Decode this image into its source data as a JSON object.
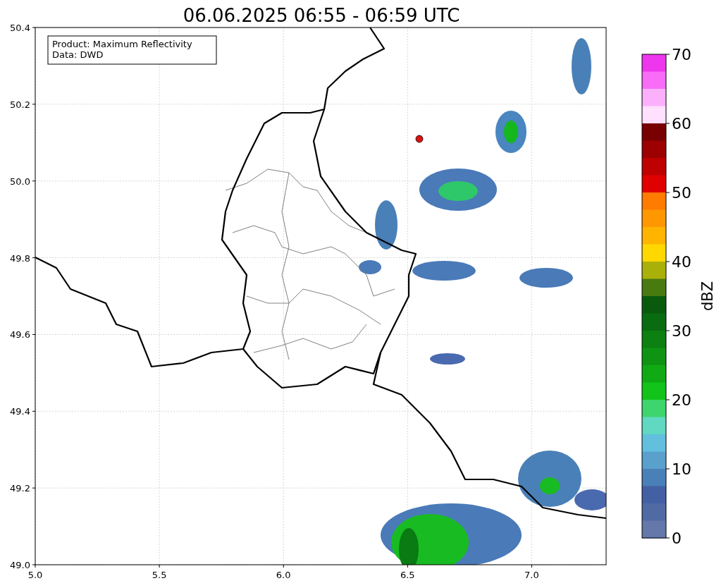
{
  "title": "06.06.2025 06:55 - 06:59 UTC",
  "info_box": {
    "lines": [
      "Product: Maximum Reflectivity",
      "Data: DWD"
    ]
  },
  "x_ticks": [
    "5.0",
    "5.5",
    "6.0",
    "6.5",
    "7.0"
  ],
  "y_ticks": [
    "50.4",
    "50.2",
    "50.0",
    "49.8",
    "49.6",
    "49.4",
    "49.2",
    "49.0"
  ],
  "colorbar": {
    "label": "dBZ",
    "ticks": [
      "70",
      "60",
      "50",
      "40",
      "30",
      "20",
      "10",
      "0"
    ],
    "bins": [
      {
        "color": "#ee36ee"
      },
      {
        "color": "#f86cf8"
      },
      {
        "color": "#fcb0fc"
      },
      {
        "color": "#ffe0ff"
      },
      {
        "color": "#780000"
      },
      {
        "color": "#9c0000"
      },
      {
        "color": "#be0000"
      },
      {
        "color": "#e00000"
      },
      {
        "color": "#ff7c00"
      },
      {
        "color": "#ff9800"
      },
      {
        "color": "#ffb400"
      },
      {
        "color": "#ffd800"
      },
      {
        "color": "#aab00a"
      },
      {
        "color": "#487a10"
      },
      {
        "color": "#0a5a0e"
      },
      {
        "color": "#0a6c10"
      },
      {
        "color": "#0c8010"
      },
      {
        "color": "#0e9412"
      },
      {
        "color": "#10aa14"
      },
      {
        "color": "#12c41a"
      },
      {
        "color": "#3ed46e"
      },
      {
        "color": "#60d8c2"
      },
      {
        "color": "#62c0de"
      },
      {
        "color": "#5aa0cc"
      },
      {
        "color": "#4a80b8"
      },
      {
        "color": "#4460a4"
      },
      {
        "color": "#506aa4"
      },
      {
        "color": "#6478aa"
      }
    ]
  }
}
